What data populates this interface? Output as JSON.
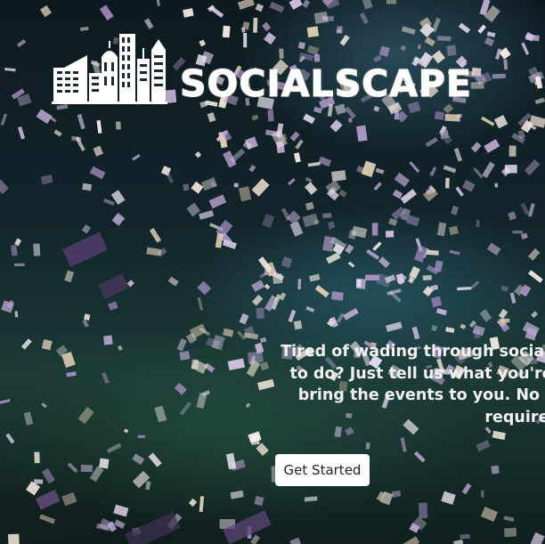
{
  "brand": {
    "name": "SOCIALSCAPE",
    "logo_icon": "city-skyline-icon"
  },
  "hero": {
    "tagline": "Tired of wading through social media to find something to do? Just tell us what you're interested in, and we'll bring the events to you. No ads or account creation required.",
    "cta_label": "Get Started"
  },
  "colors": {
    "text": "#ffffff",
    "button_bg": "#ffffff",
    "button_text": "#212529"
  }
}
